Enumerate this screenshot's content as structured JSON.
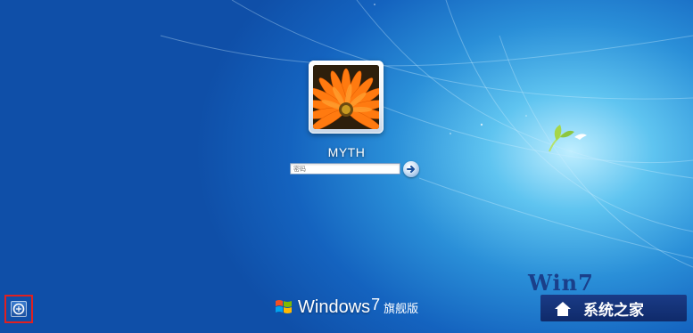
{
  "user": {
    "name": "MYTH"
  },
  "password": {
    "placeholder": "密码"
  },
  "branding": {
    "windows_word": "Windows",
    "windows_version": "7",
    "edition": "旗舰版"
  },
  "watermark": {
    "top_text": "Win7",
    "site_name": "系统之家"
  },
  "icons": {
    "submit": "arrow-right-icon",
    "ease_of_access": "ease-of-access-icon",
    "windows_flag": "windows-flag-icon",
    "bird": "bird-icon"
  },
  "colors": {
    "background": "#1463bf",
    "accent": "#1a3b86"
  }
}
